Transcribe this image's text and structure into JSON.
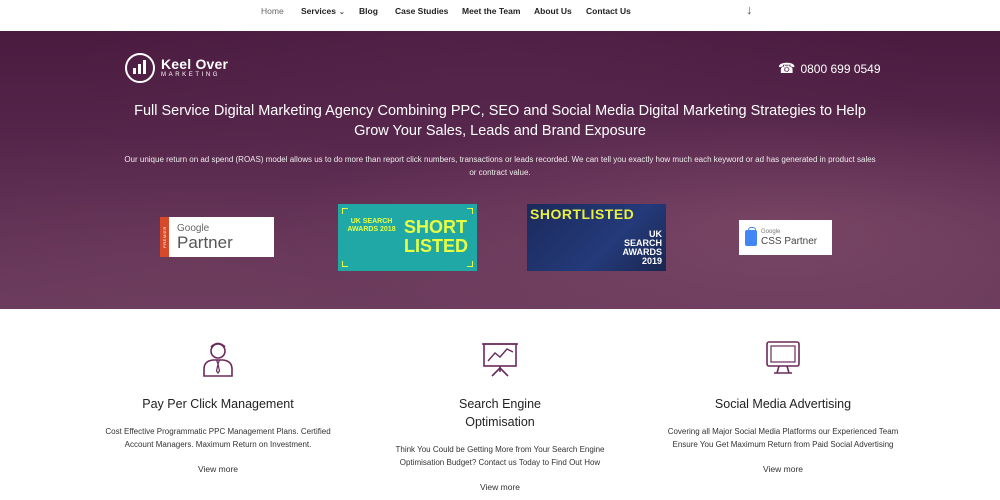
{
  "nav": {
    "items": [
      {
        "label": "Home",
        "active": true
      },
      {
        "label": "Services",
        "has_dropdown": true
      },
      {
        "label": "Blog"
      },
      {
        "label": "Case Studies"
      },
      {
        "label": "Meet the Team"
      },
      {
        "label": "About Us"
      },
      {
        "label": "Contact Us"
      }
    ],
    "caret": "⌄",
    "scroll_arrow": "↓"
  },
  "hero": {
    "logo": {
      "name": "Keel Over",
      "sub": "MARKETING"
    },
    "phone_icon": "☎",
    "phone": "0800 699 0549",
    "title_line1": "Full Service Digital Marketing Agency Combining PPC, SEO and Social Media Digital Marketing Strategies to Help",
    "title_line2": "Grow Your Sales, Leads and Brand Exposure",
    "description": "Our unique return on ad spend (ROAS) model allows us to do more than report click numbers, transactions or leads recorded. We can tell you exactly how much each keyword or ad has generated in product sales or contract value.",
    "badges": {
      "google_partner": {
        "strip": "PREMIER",
        "google": "Google",
        "partner": "Partner"
      },
      "uk_2018": {
        "left": "UK SEARCH AWARDS 2018",
        "right_line1": "SHORT",
        "right_line2": "LISTED"
      },
      "uk_2019": {
        "short": "SHORTLISTED",
        "right_line1": "UK",
        "right_line2": "SEARCH",
        "right_line3": "AWARDS",
        "right_line4": "2019"
      },
      "css_partner": {
        "google": "Google",
        "partner": "CSS Partner"
      }
    }
  },
  "services": [
    {
      "icon": "person-tie-icon",
      "title": "Pay Per Click Management",
      "desc_line1": "Cost Effective Programmatic PPC Management Plans. Certified",
      "desc_line2": "Account Managers. Maximum Return on Investment.",
      "more": "View more"
    },
    {
      "icon": "chart-presentation-icon",
      "title_line1": "Search Engine",
      "title_line2": "Optimisation",
      "desc_line1": "Think You Could be Getting More from Your Search Engine",
      "desc_line2": "Optimisation Budget? Contact us Today to Find Out How",
      "more": "View more"
    },
    {
      "icon": "monitor-icon",
      "title": "Social Media Advertising",
      "desc_line1": "Covering all Major Social Media Platforms our Experienced Team",
      "desc_line2": "Ensure You Get Maximum Return from Paid Social Advertising",
      "more": "View more"
    }
  ],
  "colors": {
    "hero_bg": "#4a1b3f",
    "accent_purple": "#5a2a4f",
    "award_teal": "#1fa8a6",
    "award_yellow": "#e9ff40"
  }
}
